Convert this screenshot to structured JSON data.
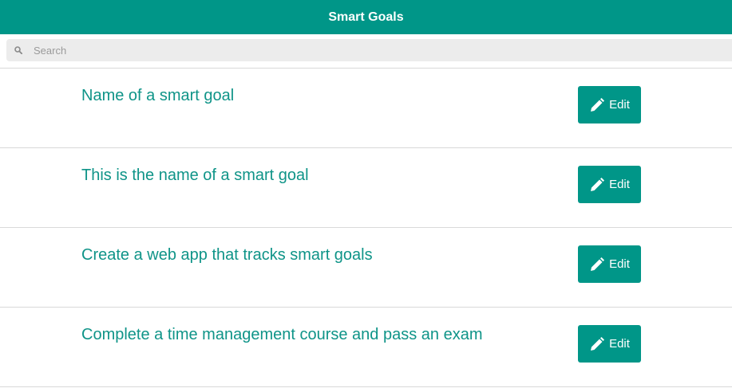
{
  "header": {
    "title": "Smart Goals"
  },
  "search": {
    "placeholder": "Search",
    "value": "",
    "icon": "search-icon"
  },
  "goals": [
    {
      "title": "Name of a smart goal",
      "edit_label": "Edit"
    },
    {
      "title": "This is the name of a smart goal",
      "edit_label": "Edit"
    },
    {
      "title": "Create a web app that tracks smart goals",
      "edit_label": "Edit"
    },
    {
      "title": "Complete a time management course and pass an exam",
      "edit_label": "Edit"
    }
  ],
  "colors": {
    "accent": "#009688",
    "title_text": "#0f9488",
    "search_bg": "#ececec"
  }
}
